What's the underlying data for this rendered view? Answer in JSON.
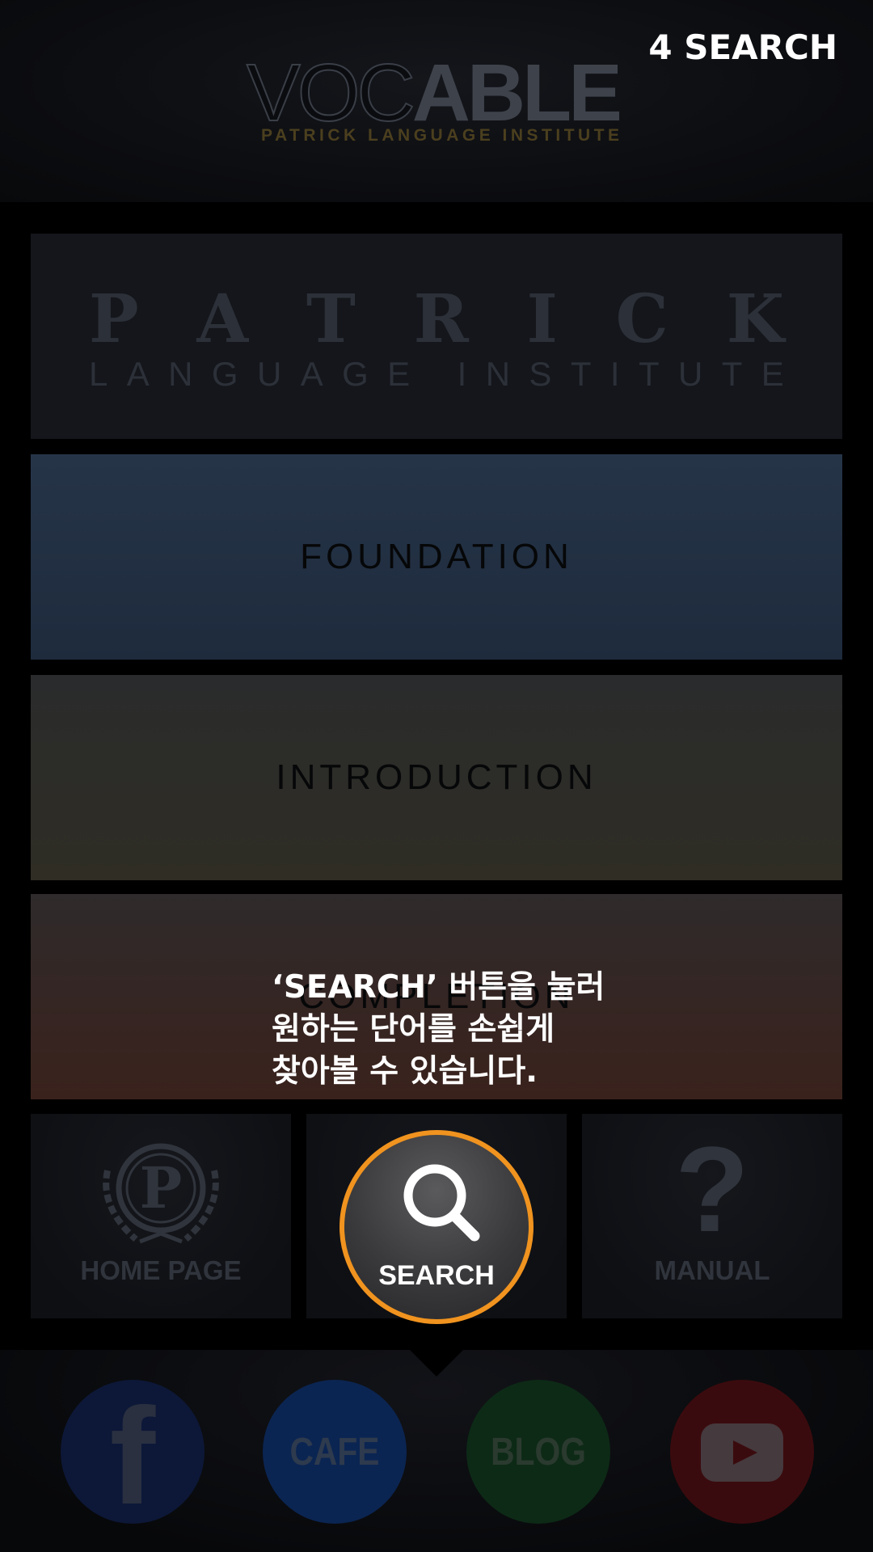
{
  "header": {
    "logo_part1": "VOC",
    "logo_part2": "ABLE",
    "logo_subtitle": "PATRICK LANGUAGE INSTITUTE",
    "step_title": "4 SEARCH"
  },
  "panels": {
    "patrick": {
      "title": "PATRICK",
      "subtitle": "LANGUAGE INSTITUTE"
    },
    "foundation": {
      "label": "FOUNDATION"
    },
    "introduction": {
      "label": "INTRODUCTION"
    },
    "completion": {
      "label": "COMPLETION"
    }
  },
  "tooltip": {
    "lines": [
      "‘SEARCH’ 버튼을 눌러",
      "원하는 단어를 손쉽게",
      "찾아볼 수 있습니다."
    ]
  },
  "tiles": {
    "home": {
      "label": "HOME PAGE",
      "icon": "laurel-p-icon"
    },
    "search": {
      "label": "SEARCH",
      "icon": "magnifier-icon"
    },
    "manual": {
      "label": "MANUAL",
      "icon": "question-mark-icon",
      "glyph": "?"
    }
  },
  "social": {
    "facebook": {
      "glyph": "f",
      "icon": "facebook-icon"
    },
    "cafe": {
      "label": "CAFE"
    },
    "blog": {
      "label": "BLOG"
    },
    "youtube": {
      "icon": "youtube-icon"
    }
  },
  "colors": {
    "highlight_ring": "#f0931f",
    "foundation": "#263448",
    "introduction": "#2f2d24",
    "completion": "#3a221c"
  }
}
